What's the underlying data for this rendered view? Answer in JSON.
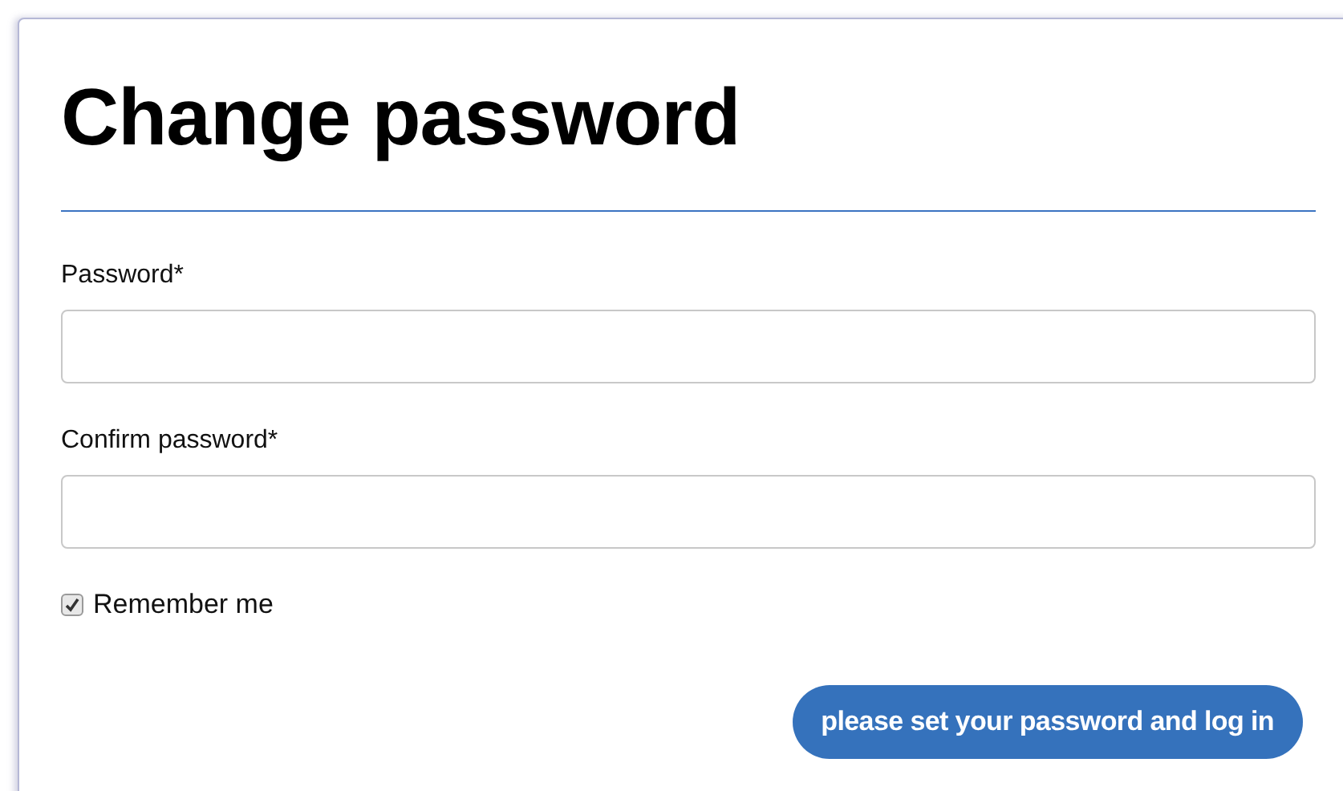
{
  "title": "Change password",
  "fields": [
    {
      "label": "Password*"
    },
    {
      "label": "Confirm password*"
    }
  ],
  "remember": {
    "label": "Remember me",
    "checked": true
  },
  "submit": {
    "label": "please set your password and log in"
  }
}
